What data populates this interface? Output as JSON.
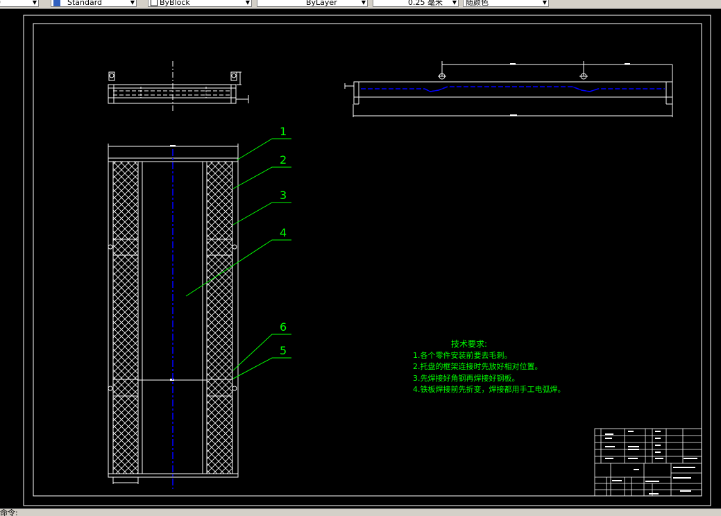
{
  "toolbar": {
    "items": [
      "0",
      "Standard",
      "ByBlock",
      "ByLayer",
      "0.25 毫米",
      "随颜色"
    ]
  },
  "drawing": {
    "part_numbers": [
      "1",
      "2",
      "3",
      "4",
      "6",
      "5"
    ],
    "tech_title": "技术要求:",
    "tech_lines": [
      "1.各个零件安装前要去毛刺。",
      "2.托盘的框架连接时先放好相对位置。",
      "3.先焊接好角钢再焊接好钢板。",
      "4.铁板焊接前先折变，焊接都用手工电弧焊。"
    ]
  },
  "statusbar": {
    "text": "命令:"
  },
  "colors": {
    "background": "#000000",
    "line": "#ffffff",
    "leader": "#00ff00",
    "centerline": "#0000ff"
  }
}
